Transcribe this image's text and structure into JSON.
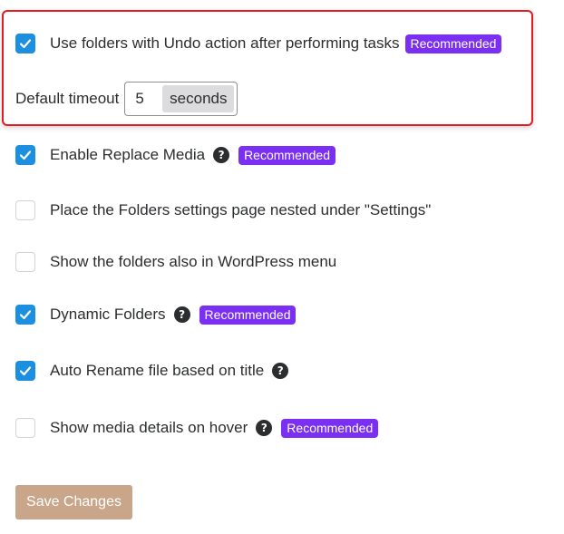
{
  "settings": {
    "undo_folders": {
      "label": "Use folders with Undo action after performing tasks",
      "checked": true,
      "badge": "Recommended"
    },
    "default_timeout": {
      "label": "Default timeout",
      "value": "5",
      "unit": "seconds"
    },
    "replace_media": {
      "label": "Enable Replace Media",
      "checked": true,
      "badge": "Recommended"
    },
    "nested_settings": {
      "label": "Place the Folders settings page nested under \"Settings\"",
      "checked": false
    },
    "wp_menu": {
      "label": "Show the folders also in WordPress menu",
      "checked": false
    },
    "dynamic_folders": {
      "label": "Dynamic Folders",
      "checked": true,
      "badge": "Recommended"
    },
    "auto_rename": {
      "label": "Auto Rename file based on title",
      "checked": true
    },
    "media_details": {
      "label": "Show media details on hover",
      "checked": false,
      "badge": "Recommended"
    }
  },
  "save_button": {
    "label": "Save Changes"
  },
  "icons": {
    "help": "?",
    "check": "checkmark-icon"
  },
  "colors": {
    "checkbox_checked": "#1d8fe1",
    "badge": "#7b2ff2",
    "highlight_border": "#e31b23",
    "save_button": "#c9a68a"
  }
}
